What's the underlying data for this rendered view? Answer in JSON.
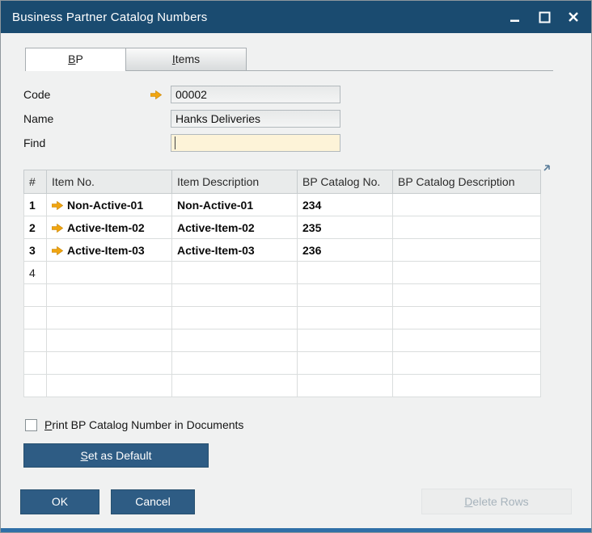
{
  "window": {
    "title": "Business Partner Catalog Numbers"
  },
  "tabs": [
    {
      "label": "BP",
      "accesskey": "B",
      "active": true
    },
    {
      "label": "Items",
      "accesskey": "I",
      "active": false
    }
  ],
  "form": {
    "code": {
      "label": "Code",
      "value": "00002"
    },
    "name": {
      "label": "Name",
      "value": "Hanks Deliveries"
    },
    "find": {
      "label": "Find",
      "value": "",
      "placeholder": ""
    }
  },
  "table": {
    "columns": [
      "#",
      "Item No.",
      "Item Description",
      "BP Catalog No.",
      "BP Catalog Description"
    ],
    "rows": [
      {
        "num": "1",
        "item_no": "Non-Active-01",
        "item_description": "Non-Active-01",
        "bp_catalog_no": "234",
        "bp_catalog_description": "",
        "bold": true,
        "link_arrow": true
      },
      {
        "num": "2",
        "item_no": "Active-Item-02",
        "item_description": "Active-Item-02",
        "bp_catalog_no": "235",
        "bp_catalog_description": "",
        "bold": true,
        "link_arrow": true
      },
      {
        "num": "3",
        "item_no": "Active-Item-03",
        "item_description": "Active-Item-03",
        "bp_catalog_no": "236",
        "bp_catalog_description": "",
        "bold": true,
        "link_arrow": true
      },
      {
        "num": "4",
        "item_no": "",
        "item_description": "",
        "bp_catalog_no": "",
        "bp_catalog_description": "",
        "bold": false,
        "link_arrow": false
      },
      {
        "num": "",
        "item_no": "",
        "item_description": "",
        "bp_catalog_no": "",
        "bp_catalog_description": "",
        "bold": false,
        "link_arrow": false
      },
      {
        "num": "",
        "item_no": "",
        "item_description": "",
        "bp_catalog_no": "",
        "bp_catalog_description": "",
        "bold": false,
        "link_arrow": false
      },
      {
        "num": "",
        "item_no": "",
        "item_description": "",
        "bp_catalog_no": "",
        "bp_catalog_description": "",
        "bold": false,
        "link_arrow": false
      },
      {
        "num": "",
        "item_no": "",
        "item_description": "",
        "bp_catalog_no": "",
        "bp_catalog_description": "",
        "bold": false,
        "link_arrow": false
      },
      {
        "num": "",
        "item_no": "",
        "item_description": "",
        "bp_catalog_no": "",
        "bp_catalog_description": "",
        "bold": false,
        "link_arrow": false
      }
    ]
  },
  "checkbox": {
    "label": "Print BP Catalog Number in Documents",
    "accesskey": "P",
    "checked": false
  },
  "buttons": {
    "set_as_default": {
      "label": "Set as Default",
      "accesskey": "S"
    },
    "ok": {
      "label": "OK"
    },
    "cancel": {
      "label": "Cancel"
    },
    "delete_rows": {
      "label": "Delete Rows",
      "accesskey": "D",
      "enabled": false
    }
  },
  "colors": {
    "titlebar": "#1a4b70",
    "button_blue": "#2e5c84",
    "find_field_bg": "#fdf3d8",
    "link_arrow": "#f0a511",
    "disabled_text": "#a7b3bc"
  }
}
